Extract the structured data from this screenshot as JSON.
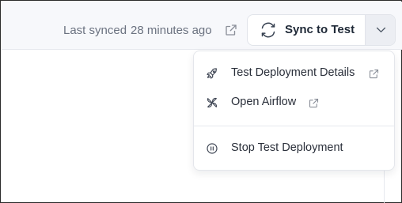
{
  "header": {
    "last_synced_label": "Last synced",
    "last_synced_time": "28 minutes ago",
    "sync_button_label": "Sync to Test"
  },
  "icons": {
    "status_link": "external-link-icon",
    "sync": "refresh-icon",
    "dropdown": "chevron-down-icon"
  },
  "dropdown_menu": {
    "items": [
      {
        "label": "Test Deployment Details",
        "icon": "rocket-icon",
        "external": true
      },
      {
        "label": "Open Airflow",
        "icon": "airflow-pinwheel-icon",
        "external": true
      },
      {
        "label": "Stop Test Deployment",
        "icon": "pause-circle-icon",
        "external": false
      }
    ]
  },
  "colors": {
    "topbar_bg": "#f7f8fb",
    "chevron_bg": "#eceef3",
    "text_muted": "#6b7280",
    "text_primary": "#1f2937"
  }
}
